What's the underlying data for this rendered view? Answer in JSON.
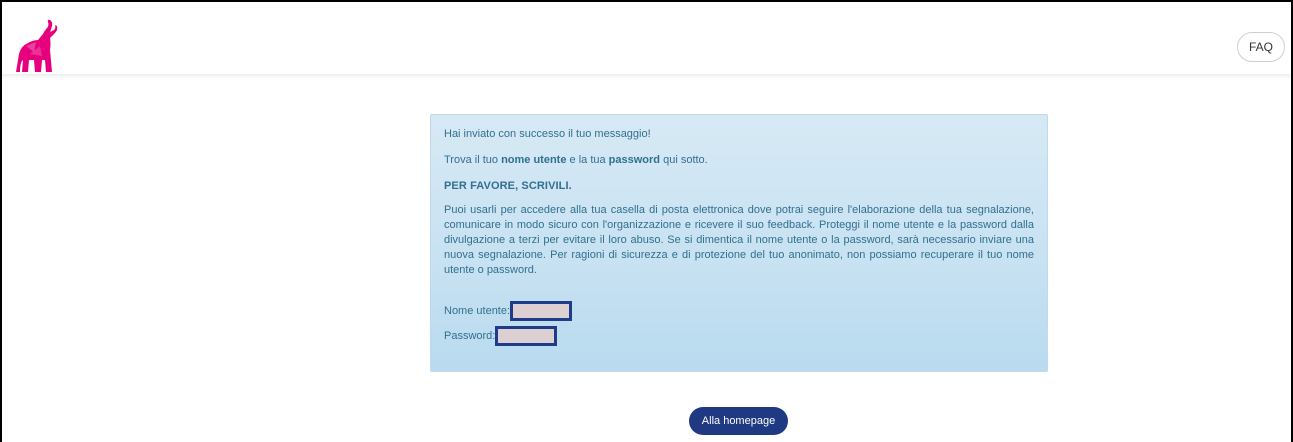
{
  "header": {
    "logo_icon": "elephant-logo-icon",
    "faq_label": "FAQ"
  },
  "panel": {
    "success_message": "Hai inviato con successo il tuo messaggio!",
    "find_text": {
      "part1": "Trova il tuo ",
      "bold1": "nome utente",
      "part2": " e la tua ",
      "bold2": "password",
      "part3": " qui sotto."
    },
    "please_write": "PER FAVORE, SCRIVILI.",
    "body_text": "Puoi usarli per accedere alla tua casella di posta elettronica dove potrai seguire l'elaborazione della tua segnalazione, comunicare in modo sicuro con l'organizzazione e ricevere il suo feedback. Proteggi il nome utente e la password dalla divulgazione a terzi per evitare il loro abuso. Se si dimentica il nome utente o la password, sarà necessario inviare una nuova segnalazione. Per ragioni di sicurezza e di protezione del tuo anonimato, non possiamo recuperare il tuo nome utente o password.",
    "username_label": "Nome utente:",
    "password_label": "Password:"
  },
  "footer": {
    "home_button_label": "Alla homepage"
  },
  "colors": {
    "logo": "#e6007e",
    "panel_text": "#31708f",
    "button_bg": "#1f3a82",
    "redaction_border": "#1f3c8a"
  }
}
